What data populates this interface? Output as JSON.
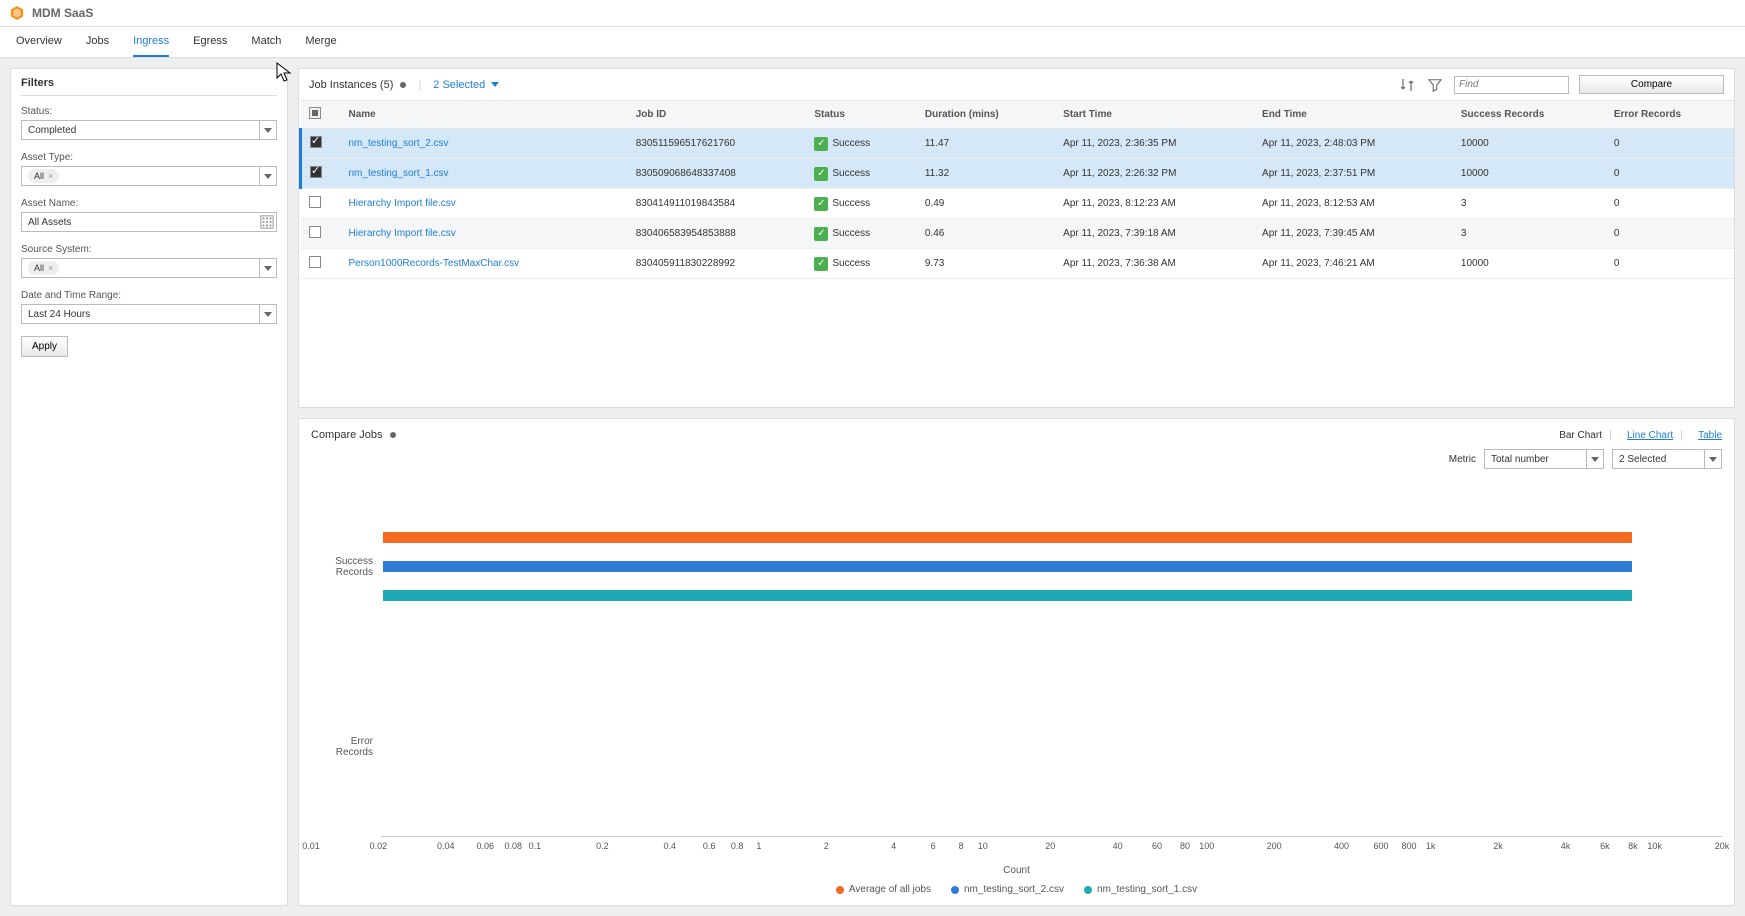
{
  "app_title": "MDM SaaS",
  "tabs": [
    "Overview",
    "Jobs",
    "Ingress",
    "Egress",
    "Match",
    "Merge"
  ],
  "active_tab": "Ingress",
  "sidebar": {
    "title": "Filters",
    "status": {
      "label": "Status:",
      "value": "Completed"
    },
    "asset_type": {
      "label": "Asset Type:",
      "chip": "All"
    },
    "asset_name": {
      "label": "Asset Name:",
      "value": "All Assets"
    },
    "source_system": {
      "label": "Source System:",
      "chip": "All"
    },
    "date_range": {
      "label": "Date and Time Range:",
      "value": "Last 24 Hours"
    },
    "apply": "Apply"
  },
  "job_instances": {
    "title": "Job Instances (5)",
    "selected_text": "2 Selected",
    "find_placeholder": "Find",
    "compare_btn": "Compare",
    "columns": [
      "Name",
      "Job ID",
      "Status",
      "Duration (mins)",
      "Start Time",
      "End Time",
      "Success Records",
      "Error Records"
    ],
    "rows": [
      {
        "checked": true,
        "name": "nm_testing_sort_2.csv",
        "job_id": "830511596517621760",
        "status": "Success",
        "duration": "11.47",
        "start": "Apr 11, 2023, 2:36:35 PM",
        "end": "Apr 11, 2023, 2:48:03 PM",
        "success": "10000",
        "error": "0"
      },
      {
        "checked": true,
        "name": "nm_testing_sort_1.csv",
        "job_id": "830509068648337408",
        "status": "Success",
        "duration": "11.32",
        "start": "Apr 11, 2023, 2:26:32 PM",
        "end": "Apr 11, 2023, 2:37:51 PM",
        "success": "10000",
        "error": "0"
      },
      {
        "checked": false,
        "name": "Hierarchy Import file.csv",
        "job_id": "830414911019843584",
        "status": "Success",
        "duration": "0.49",
        "start": "Apr 11, 2023, 8:12:23 AM",
        "end": "Apr 11, 2023, 8:12:53 AM",
        "success": "3",
        "error": "0"
      },
      {
        "checked": false,
        "name": "Hierarchy Import file.csv",
        "job_id": "830406583954853888",
        "status": "Success",
        "duration": "0.46",
        "start": "Apr 11, 2023, 7:39:18 AM",
        "end": "Apr 11, 2023, 7:39:45 AM",
        "success": "3",
        "error": "0"
      },
      {
        "checked": false,
        "name": "Person1000Records-TestMaxChar.csv",
        "job_id": "830405911830228992",
        "status": "Success",
        "duration": "9.73",
        "start": "Apr 11, 2023, 7:36:38 AM",
        "end": "Apr 11, 2023, 7:46:21 AM",
        "success": "10000",
        "error": "0"
      }
    ]
  },
  "compare_jobs": {
    "title": "Compare Jobs",
    "view_links": [
      "Bar Chart",
      "Line Chart",
      "Table"
    ],
    "active_view": "Bar Chart",
    "metric_label": "Metric",
    "metric_value": "Total number",
    "second_select": "2 Selected",
    "xaxis_title": "Count",
    "xticks": [
      "0.01",
      "0.02",
      "0.04",
      "0.06",
      "0.08",
      "0.1",
      "0.2",
      "0.4",
      "0.6",
      "0.8",
      "1",
      "2",
      "4",
      "6",
      "8",
      "10",
      "20",
      "40",
      "60",
      "80",
      "100",
      "200",
      "400",
      "600",
      "800",
      "1k",
      "2k",
      "4k",
      "6k",
      "8k",
      "10k",
      "20k"
    ],
    "ycats": [
      "Success Records",
      "Error Records"
    ],
    "legend": [
      {
        "name": "Average of all jobs",
        "color": "#f26b21"
      },
      {
        "name": "nm_testing_sort_2.csv",
        "color": "#2e7cd6"
      },
      {
        "name": "nm_testing_sort_1.csv",
        "color": "#1fa9b3"
      }
    ]
  },
  "chart_data": {
    "type": "bar",
    "orientation": "horizontal",
    "xscale": "log",
    "xlim": [
      0.01,
      20000
    ],
    "categories": [
      "Success Records",
      "Error Records"
    ],
    "xlabel": "Count",
    "series": [
      {
        "name": "Average of all jobs",
        "color": "#f26b21",
        "values": [
          10000,
          0
        ]
      },
      {
        "name": "nm_testing_sort_2.csv",
        "color": "#2e7cd6",
        "values": [
          10000,
          0
        ]
      },
      {
        "name": "nm_testing_sort_1.csv",
        "color": "#1fa9b3",
        "values": [
          10000,
          0
        ]
      }
    ]
  }
}
